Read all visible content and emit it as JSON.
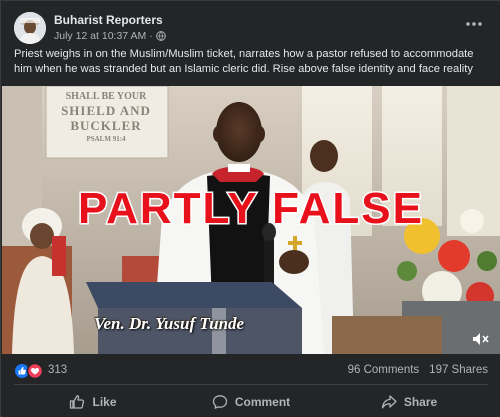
{
  "post": {
    "page_name": "Buharist Reporters",
    "timestamp": "July 12 at 10:37 AM",
    "separator": "·",
    "audience_icon": "globe-icon",
    "more_icon": "more-options-icon",
    "caption": "Priest weighs in on the Muslim/Muslim ticket, narrates how a pastor refused to accommodate him when he was stranded but an Islamic cleric did. Rise above false identity and face reality"
  },
  "media": {
    "stamp": "PARTLY FALSE",
    "nameplate": "Ven. Dr. Yusuf Tunde",
    "banner_line1": "SHALL BE YOUR",
    "banner_line2": "SHIELD AND",
    "banner_line3": "BUCKLER",
    "banner_line4": "PSALM 91:4",
    "mute_icon": "volume-muted-icon"
  },
  "stats": {
    "reaction_icons": [
      "like-icon",
      "love-icon"
    ],
    "reaction_count": "313",
    "comments": "96 Comments",
    "shares": "197 Shares"
  },
  "actions": {
    "like": "Like",
    "comment": "Comment",
    "share": "Share"
  },
  "colors": {
    "card_bg": "#242526",
    "text_primary": "#e4e6eb",
    "text_secondary": "#b0b3b8",
    "stamp_red": "#e8111b",
    "like_blue": "#1877f2",
    "love_red": "#f33e58"
  }
}
